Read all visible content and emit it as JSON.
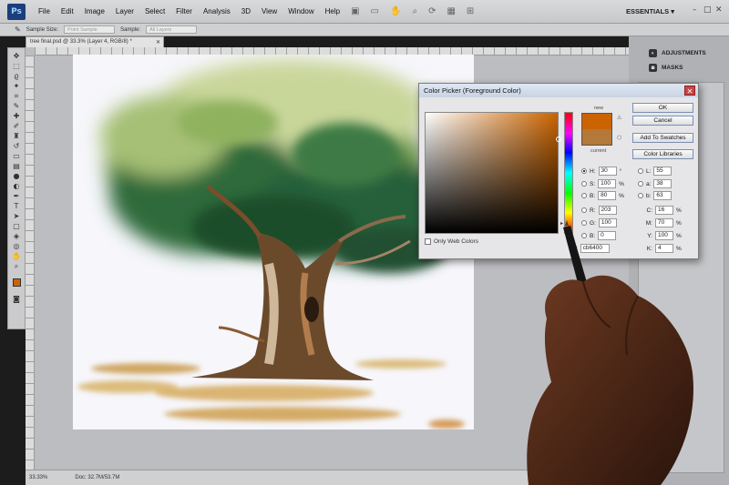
{
  "app": {
    "logo": "Ps",
    "workspace": "ESSENTIALS ▾"
  },
  "menu": [
    "File",
    "Edit",
    "Image",
    "Layer",
    "Select",
    "Filter",
    "Analysis",
    "3D",
    "View",
    "Window",
    "Help"
  ],
  "options_bar": {
    "sample_size_label": "Sample Size:",
    "sample_size_value": "Point Sample",
    "sample_label": "Sample:",
    "sample_value": "All Layers"
  },
  "document": {
    "tab_title": "tree final.psd @ 33.3% (Layer 4, RGB/8) *",
    "zoom": "33.33%",
    "doc_size": "Doc: 32.7M/53.7M"
  },
  "panels": {
    "adjustments": "ADJUSTMENTS",
    "masks": "MASKS"
  },
  "color_picker": {
    "title": "Color Picker (Foreground Color)",
    "close": "✕",
    "new_label": "new",
    "current_label": "current",
    "buttons": {
      "ok": "OK",
      "cancel": "Cancel",
      "add_swatches": "Add To Swatches",
      "color_libraries": "Color Libraries"
    },
    "only_web": "Only Web Colors",
    "hsb": [
      {
        "label": "H:",
        "value": "30",
        "unit": "°"
      },
      {
        "label": "S:",
        "value": "100",
        "unit": "%"
      },
      {
        "label": "B:",
        "value": "80",
        "unit": "%"
      }
    ],
    "rgb": [
      {
        "label": "R:",
        "value": "203"
      },
      {
        "label": "G:",
        "value": "100"
      },
      {
        "label": "B:",
        "value": "0"
      }
    ],
    "lab": [
      {
        "label": "L:",
        "value": "55"
      },
      {
        "label": "a:",
        "value": "38"
      },
      {
        "label": "b:",
        "value": "63"
      }
    ],
    "cmyk": [
      {
        "label": "C:",
        "value": "16",
        "unit": "%"
      },
      {
        "label": "M:",
        "value": "70",
        "unit": "%"
      },
      {
        "label": "Y:",
        "value": "100",
        "unit": "%"
      },
      {
        "label": "K:",
        "value": "4",
        "unit": "%"
      }
    ],
    "hex_label": "#",
    "hex": "cb6400",
    "new_color": "#cb6400",
    "current_color": "#b47838"
  }
}
